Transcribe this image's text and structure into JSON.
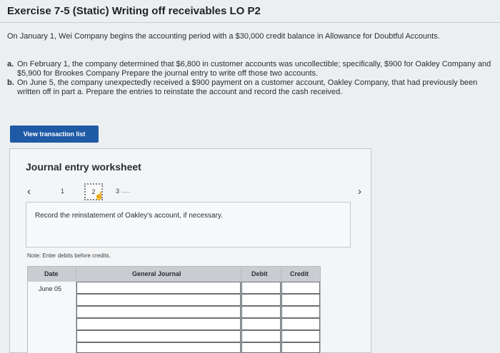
{
  "header": {
    "title": "Exercise 7-5 (Static) Writing off receivables LO P2"
  },
  "intro": "On January 1, Wei Company begins the accounting period with a $30,000 credit balance in Allowance for Doubtful Accounts.",
  "parts": [
    {
      "letter": "a.",
      "text": "On February 1, the company determined that $6,800 in customer accounts was uncollectible; specifically, $900 for Oakley Company and $5,900 for Brookes Company Prepare the journal entry to write off those two accounts."
    },
    {
      "letter": "b.",
      "text": "On June 5, the company unexpectedly received a $900 payment on a customer account, Oakley Company, that had previously been written off in part a. Prepare the entries to reinstate the account and record the cash received."
    }
  ],
  "view_button": "View transaction list",
  "worksheet": {
    "title": "Journal entry worksheet",
    "pages": [
      "1",
      "2",
      "3"
    ],
    "current_page": "2",
    "instruction": "Record the reinstatement of Oakley's account, if necessary.",
    "note": "Note: Enter debits before credits.",
    "columns": {
      "date": "Date",
      "general_journal": "General Journal",
      "debit": "Debit",
      "credit": "Credit"
    },
    "rows": [
      {
        "date": "June 05",
        "account": "",
        "debit": "",
        "credit": ""
      },
      {
        "date": "",
        "account": "",
        "debit": "",
        "credit": ""
      },
      {
        "date": "",
        "account": "",
        "debit": "",
        "credit": ""
      },
      {
        "date": "",
        "account": "",
        "debit": "",
        "credit": ""
      },
      {
        "date": "",
        "account": "",
        "debit": "",
        "credit": ""
      }
    ]
  }
}
